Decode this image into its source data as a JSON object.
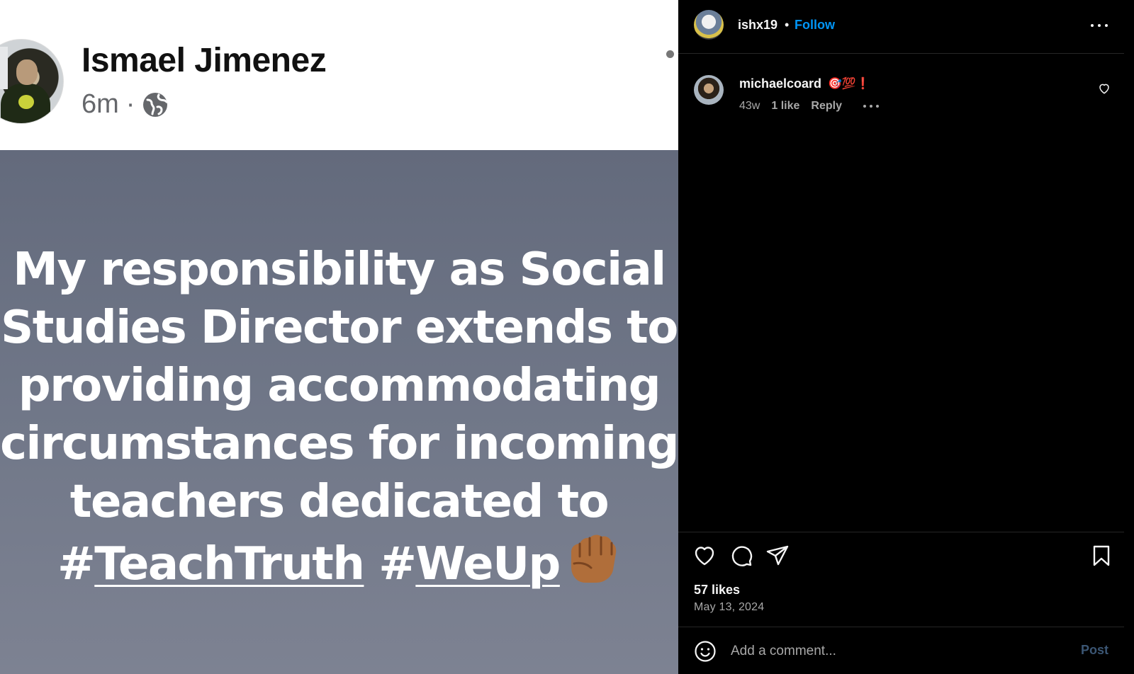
{
  "embedded_post": {
    "author_name": "Ismael Jimenez",
    "time": "6m",
    "meta_separator": "·",
    "text_lines": [
      "My responsibility as Social",
      "Studies Director extends to",
      "providing accommodating",
      "circumstances for incoming",
      "teachers dedicated to"
    ],
    "hashtag_1": "TeachTruth",
    "hashtag_2": "WeUp",
    "hash_symbol": "#",
    "background_color": "#6b7182"
  },
  "header": {
    "username": "ishx19",
    "separator": "•",
    "follow_label": "Follow",
    "follow_color": "#0095f6"
  },
  "comments": [
    {
      "username": "michaelcoard",
      "emoji_text": "🎯💯❗",
      "time": "43w",
      "likes": "1 like",
      "reply_label": "Reply"
    }
  ],
  "footer": {
    "likes": "57 likes",
    "date": "May 13, 2024",
    "comment_placeholder": "Add a comment...",
    "post_label": "Post"
  },
  "icons": {
    "like": "heart-icon",
    "comment": "comment-icon",
    "share": "share-icon",
    "save": "bookmark-icon",
    "emoji": "emoji-icon",
    "more": "more-icon",
    "globe": "globe-icon",
    "fist": "raised-fist-icon"
  }
}
